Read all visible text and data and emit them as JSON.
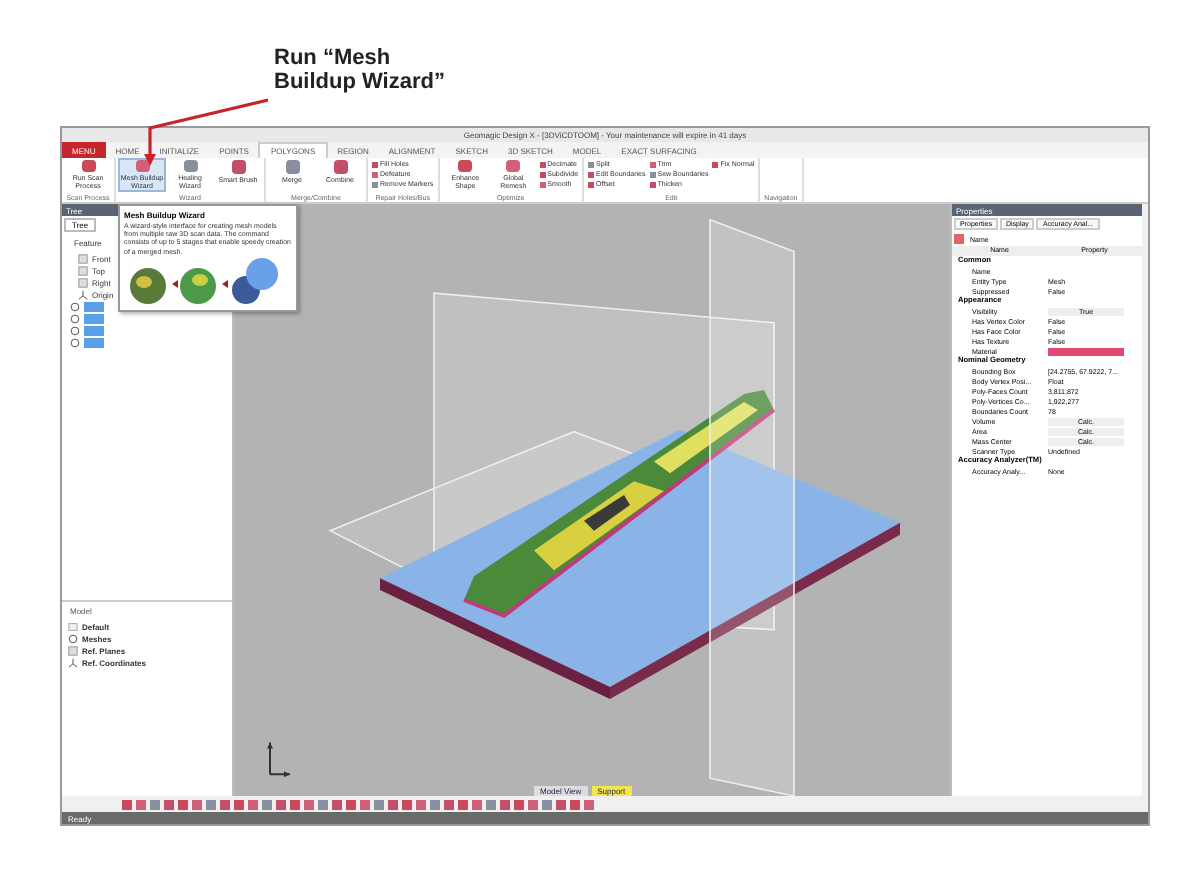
{
  "annotation": {
    "lines": [
      "Run “Mesh",
      "Buildup Wizard”"
    ]
  },
  "window": {
    "title": "Geomagic Design X - [3DViCDTOOM] - Your maintenance will expire in 41 days"
  },
  "ribbon": {
    "tabs": [
      {
        "label": "MENU",
        "kind": "menu",
        "selected": false
      },
      {
        "label": "HOME",
        "kind": "tab",
        "selected": false
      },
      {
        "label": "INITIALIZE",
        "kind": "tab",
        "selected": false
      },
      {
        "label": "POINTS",
        "kind": "tab",
        "selected": false
      },
      {
        "label": "POLYGONS",
        "kind": "tab",
        "selected": true
      },
      {
        "label": "REGION",
        "kind": "tab",
        "selected": false
      },
      {
        "label": "ALIGNMENT",
        "kind": "tab",
        "selected": false
      },
      {
        "label": "SKETCH",
        "kind": "tab",
        "selected": false
      },
      {
        "label": "3D SKETCH",
        "kind": "tab",
        "selected": false
      },
      {
        "label": "MODEL",
        "kind": "tab",
        "selected": false
      },
      {
        "label": "EXACT SURFACING",
        "kind": "tab",
        "selected": false
      }
    ],
    "groups": [
      {
        "label": "Scan Process",
        "buttons": [
          {
            "kind": "large",
            "label": "Run Scan Process",
            "pressed": false
          }
        ]
      },
      {
        "label": "Wizard",
        "buttons": [
          {
            "kind": "large",
            "label": "Mesh Buildup Wizard",
            "pressed": true
          },
          {
            "kind": "large",
            "label": "Healing Wizard",
            "pressed": false
          },
          {
            "kind": "large",
            "label": "Smart Brush",
            "pressed": false
          }
        ]
      },
      {
        "label": "Merge/Combine",
        "buttons": [
          {
            "kind": "large",
            "label": "Merge",
            "pressed": false
          },
          {
            "kind": "large",
            "label": "Combine",
            "pressed": false
          }
        ]
      },
      {
        "label": "Repair Holes/Bus",
        "buttons": [
          {
            "kind": "small",
            "label": "Fill Holes",
            "pressed": false
          },
          {
            "kind": "small",
            "label": "Defeature",
            "pressed": false
          },
          {
            "kind": "small",
            "label": "Remove Markers",
            "pressed": false
          }
        ]
      },
      {
        "label": "Optimize",
        "buttons": [
          {
            "kind": "large",
            "label": "Enhance Shape",
            "pressed": false
          },
          {
            "kind": "large",
            "label": "Global Remesh",
            "pressed": false
          },
          {
            "kind": "small",
            "label": "Decimate",
            "pressed": false
          },
          {
            "kind": "small",
            "label": "Subdivide",
            "pressed": false
          },
          {
            "kind": "small",
            "label": "Smooth",
            "pressed": false
          }
        ]
      },
      {
        "label": "Edit",
        "buttons": [
          {
            "kind": "small",
            "label": "Split",
            "pressed": false
          },
          {
            "kind": "small",
            "label": "Edit Boundaries",
            "pressed": false
          },
          {
            "kind": "small",
            "label": "Offset",
            "pressed": false
          },
          {
            "kind": "small",
            "label": "Trim",
            "pressed": false
          },
          {
            "kind": "small",
            "label": "Sew Boundaries",
            "pressed": false
          },
          {
            "kind": "small",
            "label": "Thicken",
            "pressed": false
          },
          {
            "kind": "small",
            "label": "Fix Normal",
            "pressed": false
          }
        ]
      },
      {
        "label": "Navigation"
      }
    ]
  },
  "tree_panel": {
    "title": "Tree",
    "tab": "Tree",
    "header": "Feature",
    "items": [
      {
        "kind": "plane",
        "label": "Front",
        "selected": false
      },
      {
        "kind": "plane",
        "label": "Top",
        "selected": false
      },
      {
        "kind": "plane",
        "label": "Right",
        "selected": false
      },
      {
        "kind": "origin",
        "label": "Origin",
        "selected": false
      },
      {
        "kind": "mesh",
        "selected": true
      },
      {
        "kind": "mesh",
        "selected": true
      },
      {
        "kind": "mesh",
        "selected": true
      },
      {
        "kind": "mesh",
        "selected": true
      }
    ]
  },
  "model_panel": {
    "header": "Model",
    "items": [
      {
        "kind": "root",
        "label": "Default"
      },
      {
        "kind": "mesh",
        "label": "Meshes"
      },
      {
        "kind": "plane",
        "label": "Ref. Planes"
      },
      {
        "kind": "origin",
        "label": "Ref. Coordinates"
      }
    ]
  },
  "tooltip": {
    "title": "Mesh Buildup Wizard",
    "text": "A wizard-style interface for creating mesh models from multiple raw 3D scan data. The command consists of up to 5 stages that enable speedy creation of a merged mesh."
  },
  "viewport": {
    "tabs": [
      {
        "label": "Model View",
        "selected": false
      },
      {
        "label": "Support",
        "selected": true
      }
    ]
  },
  "properties": {
    "title": "Properties",
    "tabs": [
      "Properties",
      "Display",
      "Accuracy Anal..."
    ],
    "sort_label": "Name",
    "columns": [
      "Name",
      "Property"
    ],
    "rows": [
      {
        "kind": "section",
        "label": "Common"
      },
      {
        "kind": "row",
        "name": "Name"
      },
      {
        "kind": "row",
        "name": "Entity Type",
        "value": "Mesh"
      },
      {
        "kind": "row",
        "name": "Suppressed",
        "value": "False"
      },
      {
        "kind": "section",
        "label": "Appearance"
      },
      {
        "kind": "button",
        "name": "Visibility",
        "value": "True"
      },
      {
        "kind": "row",
        "name": "Has Vertex Color",
        "value": "False"
      },
      {
        "kind": "row",
        "name": "Has Face Color",
        "value": "False"
      },
      {
        "kind": "row",
        "name": "Has Texture",
        "value": "False"
      },
      {
        "kind": "swatch",
        "name": "Material",
        "color": "#e24a72"
      },
      {
        "kind": "section",
        "label": "Nominal Geometry"
      },
      {
        "kind": "row",
        "name": "Bounding Box",
        "value": "[24.2755, 67.9222, 7..."
      },
      {
        "kind": "row",
        "name": "Body Vertex Posi...",
        "value": "Float"
      },
      {
        "kind": "row",
        "name": "Poly-Faces Count",
        "value": "3,811,872"
      },
      {
        "kind": "row",
        "name": "Poly-Vertices Co...",
        "value": "1,922,277"
      },
      {
        "kind": "row",
        "name": "Boundaries Count",
        "value": "78"
      },
      {
        "kind": "button",
        "name": "Volume",
        "value": "Calc."
      },
      {
        "kind": "button",
        "name": "Area",
        "value": "Calc."
      },
      {
        "kind": "button",
        "name": "Mass Center",
        "value": "Calc."
      },
      {
        "kind": "row",
        "name": "Scanner Type",
        "value": "Undefined"
      },
      {
        "kind": "section",
        "label": "Accuracy Analyzer(TM)"
      },
      {
        "kind": "row",
        "name": "Accuracy Analy...",
        "value": "None"
      }
    ]
  },
  "status_bar": {
    "text": "Ready"
  }
}
